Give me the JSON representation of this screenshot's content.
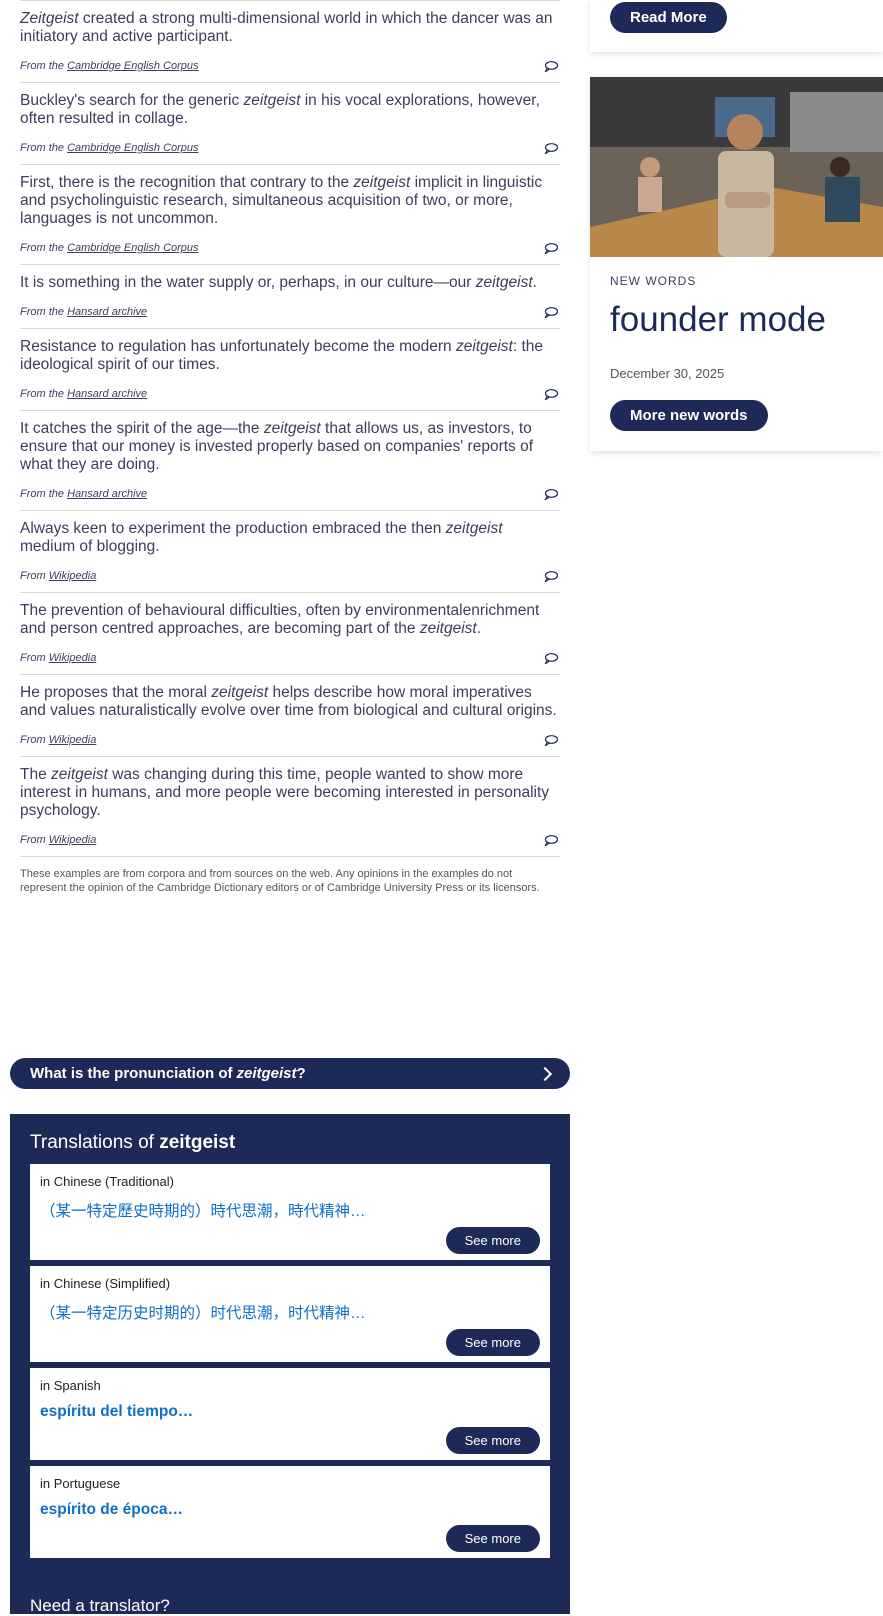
{
  "examples": [
    {
      "parts": [
        {
          "t": "Zeitgeist",
          "i": true
        },
        {
          "t": " created a strong multi-dimensional world in which the dancer was an initiatory and active participant.",
          "i": false
        }
      ],
      "from": "From the",
      "source": "Cambridge English Corpus"
    },
    {
      "parts": [
        {
          "t": "Buckley's search for the generic ",
          "i": false
        },
        {
          "t": "zeitgeist",
          "i": true
        },
        {
          "t": " in his vocal explorations, however, often resulted in collage.",
          "i": false
        }
      ],
      "from": "From the",
      "source": "Cambridge English Corpus"
    },
    {
      "parts": [
        {
          "t": "First, there is the recognition that contrary to the ",
          "i": false
        },
        {
          "t": "zeitgeist",
          "i": true
        },
        {
          "t": " implicit in linguistic and psycholinguistic research, simultaneous acquisition of two, or more, languages is not uncommon.",
          "i": false
        }
      ],
      "from": "From the",
      "source": "Cambridge English Corpus"
    },
    {
      "parts": [
        {
          "t": "It is something in the water supply or, perhaps, in our culture—our ",
          "i": false
        },
        {
          "t": "zeitgeist",
          "i": true
        },
        {
          "t": ".",
          "i": false
        }
      ],
      "from": "From the",
      "source": "Hansard archive"
    },
    {
      "parts": [
        {
          "t": "Resistance to regulation has unfortunately become the modern ",
          "i": false
        },
        {
          "t": "zeitgeist",
          "i": true
        },
        {
          "t": ": the ideological spirit of our times.",
          "i": false
        }
      ],
      "from": "From the",
      "source": "Hansard archive"
    },
    {
      "parts": [
        {
          "t": "It catches the spirit of the age—the ",
          "i": false
        },
        {
          "t": "zeitgeist",
          "i": true
        },
        {
          "t": " that allows us, as investors, to ensure that our money is invested properly based on companies' reports of what they are doing.",
          "i": false
        }
      ],
      "from": "From the",
      "source": "Hansard archive"
    },
    {
      "parts": [
        {
          "t": "Always keen to experiment the production embraced the then ",
          "i": false
        },
        {
          "t": "zeitgeist",
          "i": true
        },
        {
          "t": " medium of blogging.",
          "i": false
        }
      ],
      "from": "From",
      "source": "Wikipedia"
    },
    {
      "parts": [
        {
          "t": "The prevention of behavioural difficulties, often by environmentalenrichment and person centred approaches, are becoming part of the ",
          "i": false
        },
        {
          "t": "zeitgeist",
          "i": true
        },
        {
          "t": ".",
          "i": false
        }
      ],
      "from": "From",
      "source": "Wikipedia"
    },
    {
      "parts": [
        {
          "t": "He proposes that the moral ",
          "i": false
        },
        {
          "t": "zeitgeist",
          "i": true
        },
        {
          "t": " helps describe how moral imperatives and values naturalistically evolve over time from biological and cultural origins.",
          "i": false
        }
      ],
      "from": "From",
      "source": "Wikipedia"
    },
    {
      "parts": [
        {
          "t": "The ",
          "i": false
        },
        {
          "t": "zeitgeist",
          "i": true
        },
        {
          "t": " was changing during this time, people wanted to show more interest in humans, and more people were becoming interested in personality psychology.",
          "i": false
        }
      ],
      "from": "From",
      "source": "Wikipedia"
    }
  ],
  "disclaimer": "These examples are from corpora and from sources on the web. Any opinions in the examples do not represent the opinion of the Cambridge Dictionary editors or of Cambridge University Press or its licensors.",
  "pronunciation": {
    "prefix": "What is the pronunciation of ",
    "word": "zeitgeist",
    "suffix": "?"
  },
  "translations": {
    "title_prefix": "Translations of ",
    "word": "zeitgeist",
    "items": [
      {
        "lang": "in Chinese (Traditional)",
        "text": "（某一特定歷史時期的）時代思潮，時代精神…",
        "cjk": true,
        "button": "See more"
      },
      {
        "lang": "in Chinese (Simplified)",
        "text": "（某一特定历史时期的）时代思潮，时代精神…",
        "cjk": true,
        "button": "See more"
      },
      {
        "lang": "in Spanish",
        "text": "espíritu del tiempo…",
        "cjk": false,
        "button": "See more"
      },
      {
        "lang": "in Portuguese",
        "text": "espírito de época…",
        "cjk": false,
        "button": "See more"
      }
    ],
    "more_label": "Need a translator?"
  },
  "sidebar": {
    "read_more": "Read More",
    "new_words": {
      "kicker": "NEW WORDS",
      "title": "founder mode",
      "date": "December 30, 2025",
      "button": "More new words"
    }
  }
}
